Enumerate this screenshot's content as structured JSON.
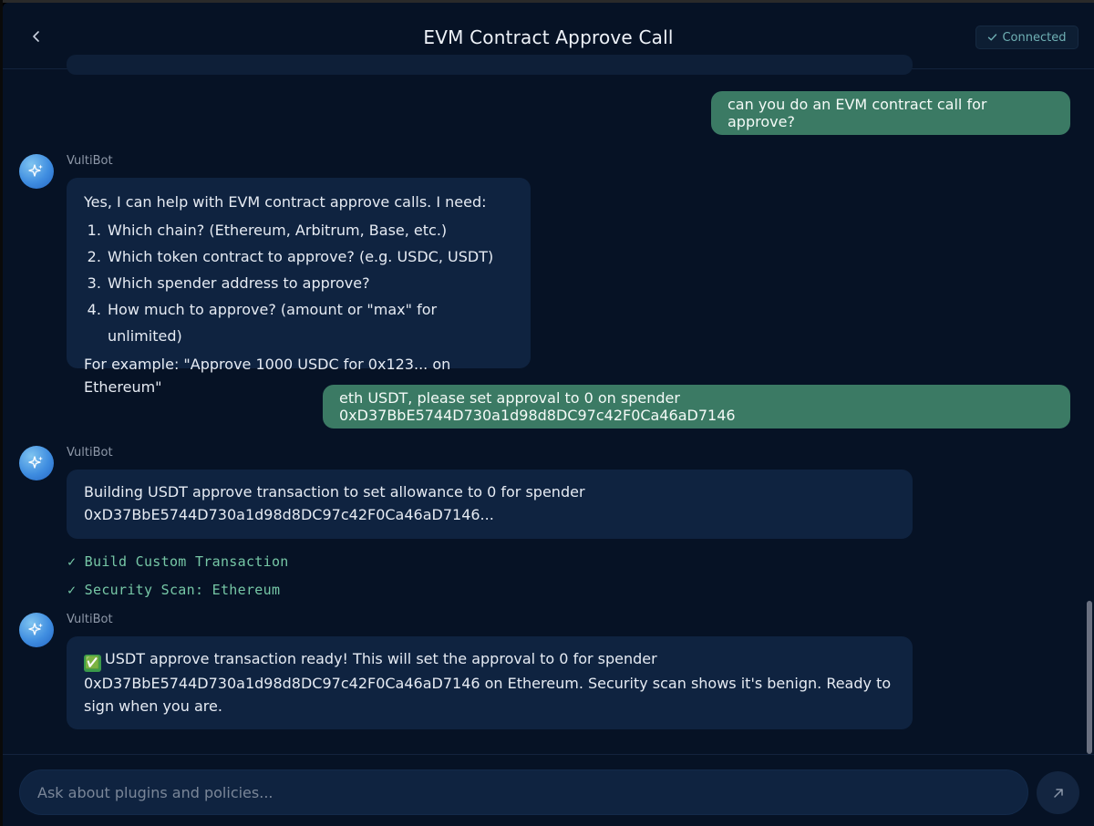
{
  "header": {
    "title": "EVM Contract Approve Call",
    "status": "Connected",
    "back_icon": "chevron-left-icon",
    "status_icon": "check-icon"
  },
  "messages": {
    "user_1": "can you do an EVM contract call for approve?",
    "bot_1": {
      "name": "VultiBot",
      "intro": "Yes, I can help with EVM contract approve calls. I need:",
      "items": [
        "Which chain? (Ethereum, Arbitrum, Base, etc.)",
        "Which token contract to approve? (e.g. USDC, USDT)",
        "Which spender address to approve?",
        "How much to approve? (amount or \"max\" for unlimited)"
      ],
      "example": "For example: \"Approve 1000 USDC for 0x123... on Ethereum\""
    },
    "user_2": "eth USDT, please set approval to 0 on spender 0xD37BbE5744D730a1d98d8DC97c42F0Ca46aD7146",
    "bot_2": {
      "name": "VultiBot",
      "line1": "Building USDT approve transaction to set allowance to 0 for spender",
      "line2": "0xD37BbE5744D730a1d98d8DC97c42F0Ca46aD7146...",
      "tools": [
        "✓ Build Custom Transaction",
        "✓ Security Scan: Ethereum"
      ]
    },
    "bot_3": {
      "name": "VultiBot",
      "emoji": "✅",
      "line1": "USDT approve transaction ready! This will set the approval to 0 for spender",
      "line2": "0xD37BbE5744D730a1d98d8DC97c42F0Ca46aD7146 on Ethereum. Security scan shows it's benign. Ready to",
      "line3": "sign when you are."
    }
  },
  "composer": {
    "placeholder": "Ask about plugins and policies...",
    "send_icon": "arrow-up-right-icon"
  },
  "colors": {
    "background": "#061225",
    "user_bubble": "#3b7a64",
    "bot_bubble": "#0f2340",
    "tool_text": "#76c7a6",
    "status_text": "#6fb0b4"
  }
}
